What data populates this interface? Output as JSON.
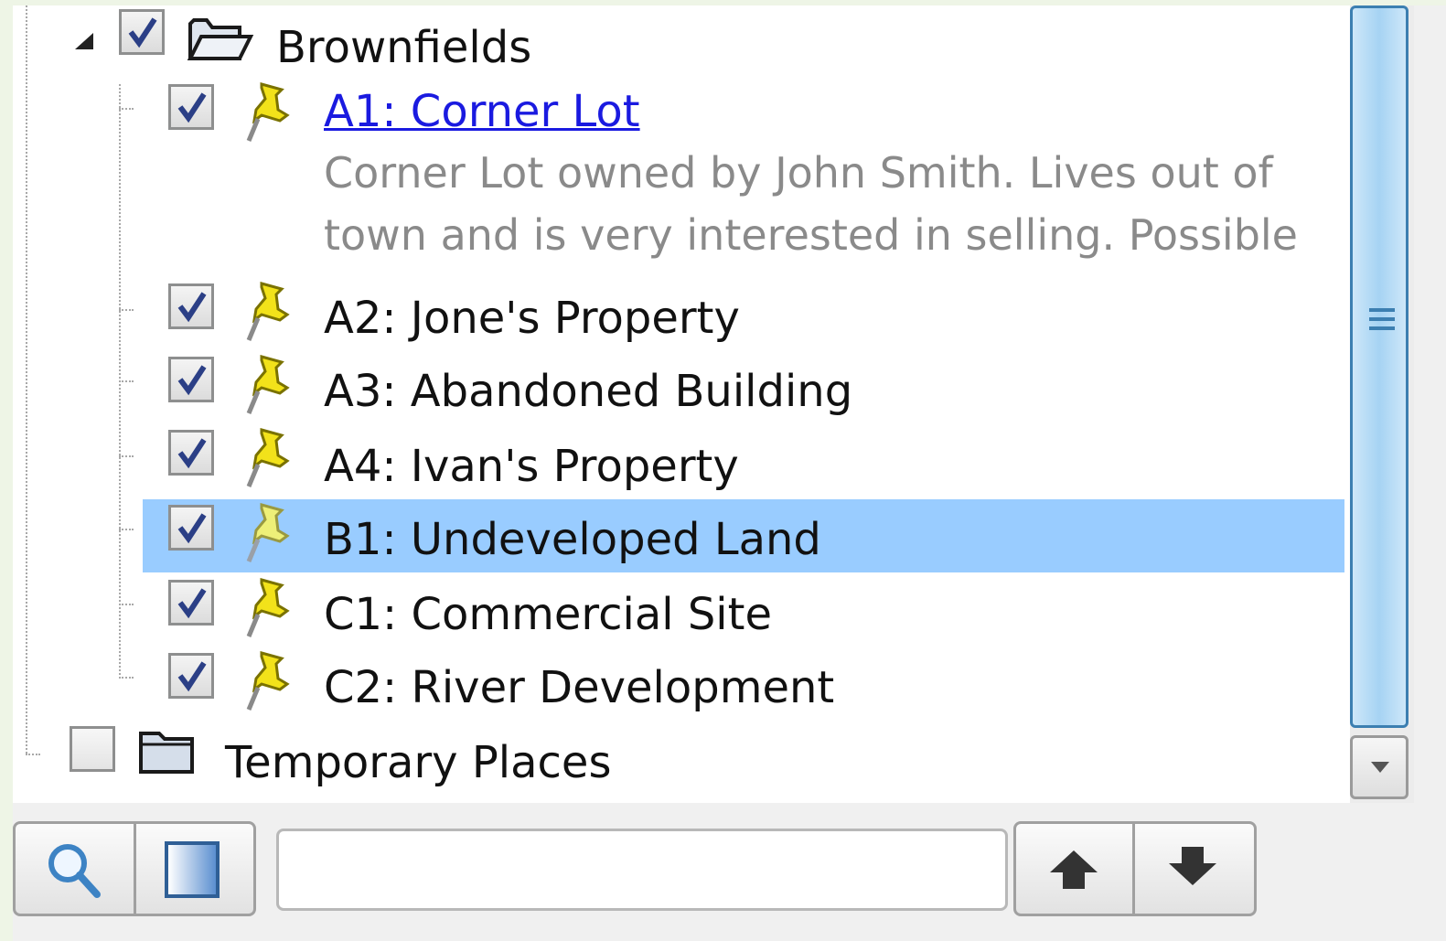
{
  "tree": {
    "root_folder": {
      "label": "Brownfields",
      "checked": true,
      "expanded": true,
      "icon": "open-folder-icon"
    },
    "places": [
      {
        "label": "A1: Corner Lot",
        "checked": true,
        "icon": "pushpin-icon",
        "link": true,
        "description": [
          "Corner Lot owned by John Smith. Lives out of",
          "town and is very interested in selling. Possible"
        ]
      },
      {
        "label": "A2: Jone's Property",
        "checked": true,
        "icon": "pushpin-icon"
      },
      {
        "label": "A3: Abandoned Building",
        "checked": true,
        "icon": "pushpin-icon"
      },
      {
        "label": "A4: Ivan's Property",
        "checked": true,
        "icon": "pushpin-icon"
      },
      {
        "label": "B1: Undeveloped Land",
        "checked": true,
        "icon": "pushpin-icon",
        "selected": true
      },
      {
        "label": "C1: Commercial Site",
        "checked": true,
        "icon": "pushpin-icon"
      },
      {
        "label": "C2: River Development",
        "checked": true,
        "icon": "pushpin-icon"
      }
    ],
    "second_folder": {
      "label": "Temporary Places",
      "checked": false,
      "icon": "closed-folder-icon"
    }
  },
  "toolbar": {
    "search_value": "",
    "buttons": [
      "search-icon",
      "list-view-icon",
      "up-arrow-icon",
      "down-arrow-icon"
    ]
  },
  "colors": {
    "selection": "#99ccff",
    "link": "#1a1ae0",
    "description": "#8a8a8a",
    "pin": "#f0e020"
  }
}
